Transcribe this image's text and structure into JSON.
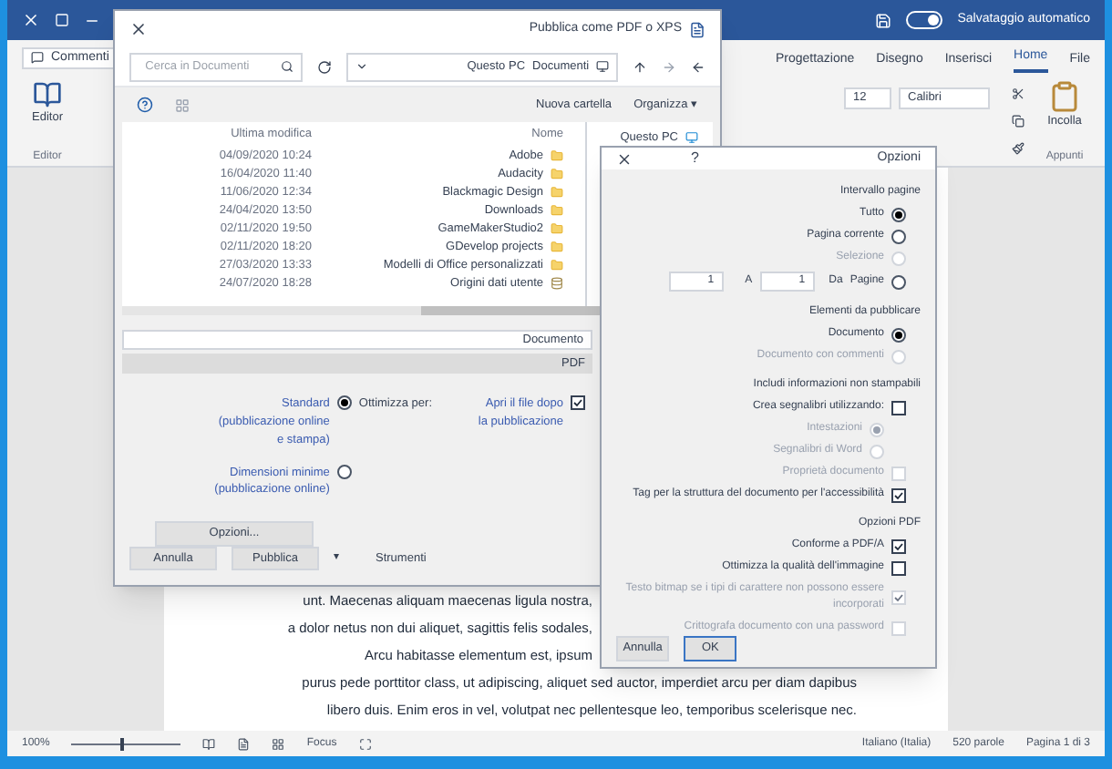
{
  "title_bar": {
    "autosave_label": "Salvataggio automatico",
    "autosave_on": true
  },
  "ribbon": {
    "tabs": [
      {
        "label": "Progettazione",
        "selected": false
      },
      {
        "label": "Disegno",
        "selected": false
      },
      {
        "label": "Inserisci",
        "selected": false
      },
      {
        "label": "Home",
        "selected": true
      },
      {
        "label": "File",
        "selected": false
      }
    ],
    "comments_button": "Commenti",
    "paste_label": "Incolla",
    "font_name": "Calibri",
    "font_size": "12",
    "clipboard_group": "Appunti",
    "editor_button": "Editor",
    "editor_group": "Editor"
  },
  "document": {
    "lines": [
      "unt. Maecenas aliquam maecenas ligula nostra,",
      "a dolor netus non dui aliquet, sagittis felis sodales,",
      "Arcu habitasse elementum est, ipsum",
      "purus pede porttitor class, ut adipiscing, aliquet sed auctor, imperdiet arcu per diam dapibus",
      "libero duis. Enim eros in vel, volutpat nec pellentesque leo, temporibus scelerisque nec."
    ]
  },
  "publish_dialog": {
    "title": "Pubblica come PDF o XPS",
    "breadcrumb": [
      "Questo PC",
      "Documenti"
    ],
    "search_placeholder": "Cerca in Documenti",
    "organize": "Organizza ▾",
    "new_folder": "Nuova cartella",
    "nav_item": "Questo PC",
    "columns": [
      "Ultima modifica",
      "Nome"
    ],
    "rows": [
      {
        "name": "Adobe",
        "modified": "04/09/2020 10:24",
        "kind": "folder"
      },
      {
        "name": "Audacity",
        "modified": "16/04/2020 11:40",
        "kind": "folder"
      },
      {
        "name": "Blackmagic Design",
        "modified": "11/06/2020 12:34",
        "kind": "folder"
      },
      {
        "name": "Downloads",
        "modified": "24/04/2020 13:50",
        "kind": "folder"
      },
      {
        "name": "GameMakerStudio2",
        "modified": "02/11/2020 19:50",
        "kind": "folder"
      },
      {
        "name": "GDevelop projects",
        "modified": "02/11/2020 18:20",
        "kind": "folder"
      },
      {
        "name": "Modelli di Office personalizzati",
        "modified": "27/03/2020 13:33",
        "kind": "folder"
      },
      {
        "name": "Origini dati utente",
        "modified": "24/07/2020 18:28",
        "kind": "data"
      }
    ],
    "filename": "Documento",
    "filetype": "PDF",
    "open_after": {
      "label": "Apri il file dopo la pubblicazione",
      "checked": true
    },
    "optimize_label": "Ottimizza per:",
    "optimize_options": [
      {
        "label": "Standard",
        "detail": "(pubblicazione online e stampa)",
        "selected": true
      },
      {
        "label": "Dimensioni minime",
        "detail": "(pubblicazione online)",
        "selected": false
      }
    ],
    "options_button": "Opzioni...",
    "tools_caret": "▾",
    "tools": "Strumenti",
    "publish_button": "Pubblica",
    "cancel_button": "Annulla"
  },
  "options_dialog": {
    "title": "Opzioni",
    "help": "?",
    "sections": [
      {
        "heading": "Intervallo pagine",
        "items": [
          {
            "kind": "radio",
            "label": "Tutto",
            "selected": true,
            "disabled": false
          },
          {
            "kind": "radio",
            "label": "Pagina corrente",
            "selected": false,
            "disabled": false
          },
          {
            "kind": "radio",
            "label": "Selezione",
            "selected": false,
            "disabled": true
          },
          {
            "kind": "range",
            "label": "Pagine",
            "selected": false,
            "disabled": false,
            "from_label": "Da",
            "from": "1",
            "to_label": "A",
            "to": "1"
          }
        ]
      },
      {
        "heading": "Elementi da pubblicare",
        "items": [
          {
            "kind": "radio",
            "label": "Documento",
            "selected": true,
            "disabled": false
          },
          {
            "kind": "radio",
            "label": "Documento con commenti",
            "selected": false,
            "disabled": true
          }
        ]
      },
      {
        "heading": "Includi informazioni non stampabili",
        "items": [
          {
            "kind": "checkbox",
            "label": "Crea segnalibri utilizzando:",
            "checked": false,
            "disabled": false
          },
          {
            "kind": "subradio",
            "label": "Intestazioni",
            "selected": true,
            "disabled": true
          },
          {
            "kind": "subradio",
            "label": "Segnalibri di Word",
            "selected": false,
            "disabled": true
          },
          {
            "kind": "checkbox",
            "label": "Proprietà documento",
            "checked": false,
            "disabled": true
          },
          {
            "kind": "checkbox",
            "label": "Tag per la struttura del documento per l'accessibilità",
            "checked": true,
            "disabled": false
          }
        ]
      },
      {
        "heading": "Opzioni PDF",
        "items": [
          {
            "kind": "checkbox",
            "label": "Conforme a PDF/A",
            "checked": true,
            "disabled": false
          },
          {
            "kind": "checkbox",
            "label": "Ottimizza la qualità dell'immagine",
            "checked": false,
            "disabled": false
          },
          {
            "kind": "checkbox",
            "label": "Testo bitmap se i tipi di carattere non possono essere incorporati",
            "checked": true,
            "disabled": true
          },
          {
            "kind": "checkbox",
            "label": "Crittografa documento con una password",
            "checked": false,
            "disabled": true
          }
        ]
      }
    ],
    "ok_button": "OK",
    "cancel_button": "Annulla"
  },
  "status_bar": {
    "page": "Pagina 1 di 3",
    "words": "520 parole",
    "language": "Italiano (Italia)",
    "focus": "Focus",
    "zoom": "100%",
    "zoom_slider": {
      "level": 0.45
    }
  }
}
